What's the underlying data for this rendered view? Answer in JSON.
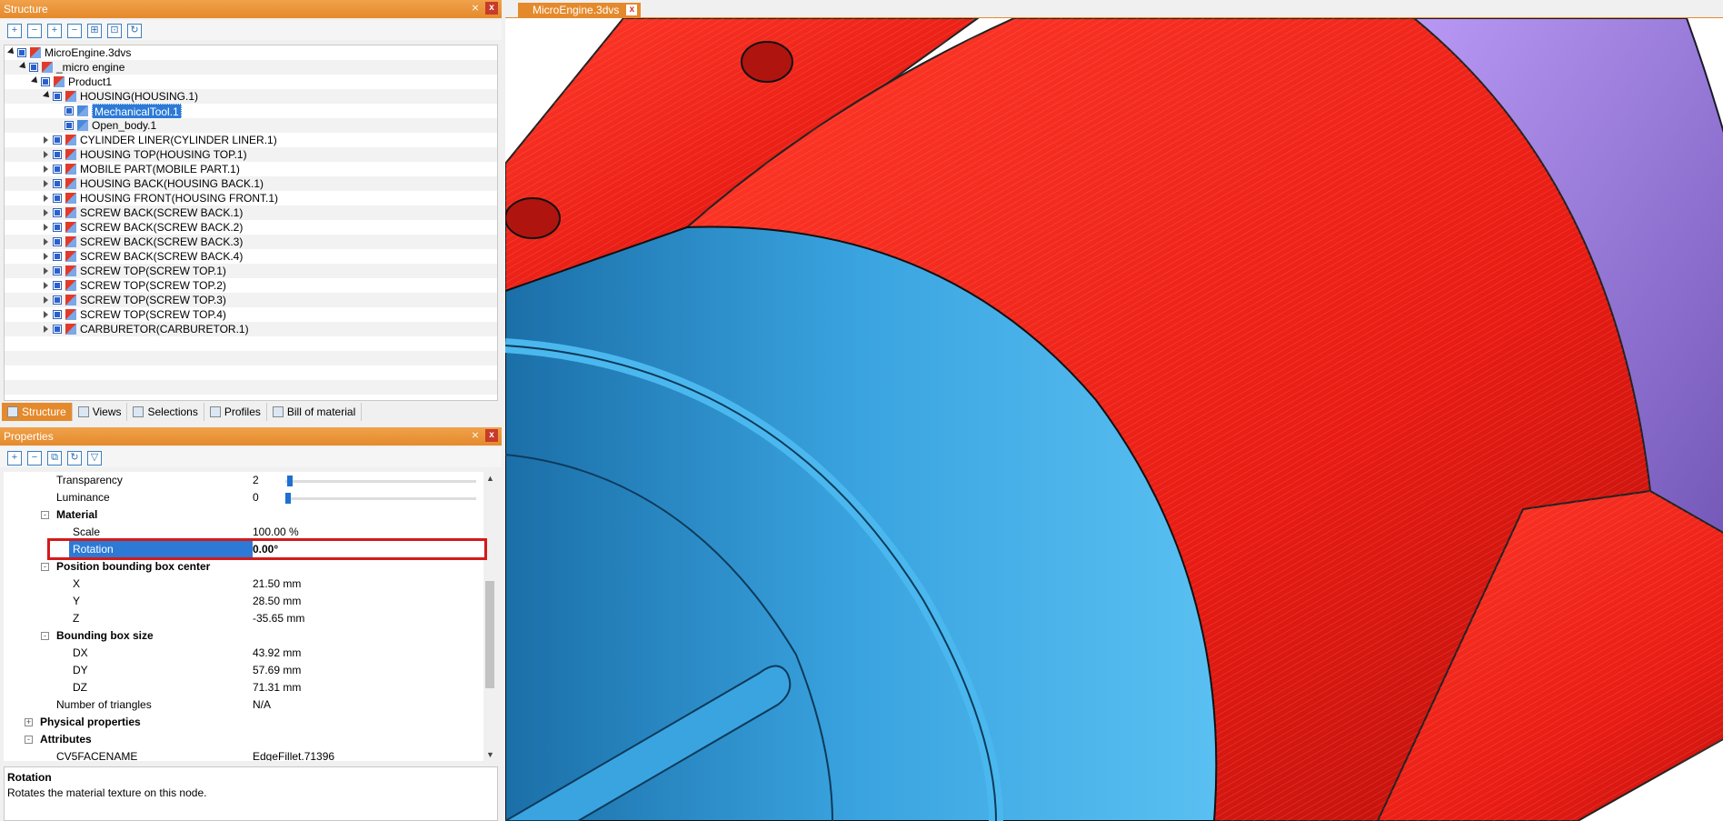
{
  "structure_panel": {
    "title": "Structure",
    "tree": [
      {
        "label": "MicroEngine.3dvs",
        "level": 0,
        "expander": "open"
      },
      {
        "label": "_micro engine",
        "level": 1,
        "expander": "open"
      },
      {
        "label": "Product1",
        "level": 2,
        "expander": "open"
      },
      {
        "label": "HOUSING(HOUSING.1)",
        "level": 3,
        "expander": "open"
      },
      {
        "label": "MechanicalTool.1",
        "level": 4,
        "expander": "none",
        "selected": true
      },
      {
        "label": "Open_body.1",
        "level": 4,
        "expander": "none"
      },
      {
        "label": "CYLINDER LINER(CYLINDER LINER.1)",
        "level": 3,
        "expander": "closed"
      },
      {
        "label": "HOUSING TOP(HOUSING TOP.1)",
        "level": 3,
        "expander": "closed"
      },
      {
        "label": "MOBILE PART(MOBILE PART.1)",
        "level": 3,
        "expander": "closed"
      },
      {
        "label": "HOUSING BACK(HOUSING BACK.1)",
        "level": 3,
        "expander": "closed"
      },
      {
        "label": "HOUSING FRONT(HOUSING FRONT.1)",
        "level": 3,
        "expander": "closed"
      },
      {
        "label": "SCREW BACK(SCREW BACK.1)",
        "level": 3,
        "expander": "closed"
      },
      {
        "label": "SCREW BACK(SCREW BACK.2)",
        "level": 3,
        "expander": "closed"
      },
      {
        "label": "SCREW BACK(SCREW BACK.3)",
        "level": 3,
        "expander": "closed"
      },
      {
        "label": "SCREW BACK(SCREW BACK.4)",
        "level": 3,
        "expander": "closed"
      },
      {
        "label": "SCREW TOP(SCREW TOP.1)",
        "level": 3,
        "expander": "closed"
      },
      {
        "label": "SCREW TOP(SCREW TOP.2)",
        "level": 3,
        "expander": "closed"
      },
      {
        "label": "SCREW TOP(SCREW TOP.3)",
        "level": 3,
        "expander": "closed"
      },
      {
        "label": "SCREW TOP(SCREW TOP.4)",
        "level": 3,
        "expander": "closed"
      },
      {
        "label": "CARBURETOR(CARBURETOR.1)",
        "level": 3,
        "expander": "closed"
      }
    ],
    "tabs": [
      {
        "label": "Structure",
        "active": true
      },
      {
        "label": "Views"
      },
      {
        "label": "Selections"
      },
      {
        "label": "Profiles"
      },
      {
        "label": "Bill of material"
      }
    ]
  },
  "properties_panel": {
    "title": "Properties",
    "rows": [
      {
        "kind": "slider",
        "label": "Transparency",
        "value": "2",
        "level": 1,
        "slider_fraction": 0.01
      },
      {
        "kind": "slider",
        "label": "Luminance",
        "value": "0",
        "level": 1,
        "slider_fraction": 0.0
      },
      {
        "kind": "group",
        "label": "Material",
        "level": 1,
        "expander": "-"
      },
      {
        "kind": "prop",
        "label": "Scale",
        "value": "100.00 %",
        "level": 2
      },
      {
        "kind": "prop",
        "label": "Rotation",
        "value": "0.00°",
        "level": 2,
        "selected": true
      },
      {
        "kind": "group",
        "label": "Position bounding box center",
        "level": 1,
        "expander": "-"
      },
      {
        "kind": "prop",
        "label": "X",
        "value": "21.50 mm",
        "level": 2
      },
      {
        "kind": "prop",
        "label": "Y",
        "value": "28.50 mm",
        "level": 2
      },
      {
        "kind": "prop",
        "label": "Z",
        "value": "-35.65 mm",
        "level": 2
      },
      {
        "kind": "group",
        "label": "Bounding box size",
        "level": 1,
        "expander": "-"
      },
      {
        "kind": "prop",
        "label": "DX",
        "value": "43.92 mm",
        "level": 2
      },
      {
        "kind": "prop",
        "label": "DY",
        "value": "57.69 mm",
        "level": 2
      },
      {
        "kind": "prop",
        "label": "DZ",
        "value": "71.31 mm",
        "level": 2
      },
      {
        "kind": "prop",
        "label": "Number of triangles",
        "value": "N/A",
        "level": 1
      },
      {
        "kind": "group",
        "label": "Physical properties",
        "level": 0,
        "expander": "+"
      },
      {
        "kind": "group",
        "label": "Attributes",
        "level": 0,
        "expander": "-"
      },
      {
        "kind": "prop",
        "label": "CV5FACENAME",
        "value": "EdgeFillet.71396",
        "level": 1
      }
    ],
    "description": {
      "title": "Rotation",
      "text": "Rotates the material texture on this node."
    }
  },
  "document": {
    "tab_label": "MicroEngine.3dvs"
  },
  "colors": {
    "accent": "#e58a2c",
    "selection": "#2c7ad6",
    "highlight_box": "#d41a1a",
    "part_red": "#e8201a",
    "part_blue": "#3aa4e0",
    "part_purple": "#a98ae8"
  }
}
